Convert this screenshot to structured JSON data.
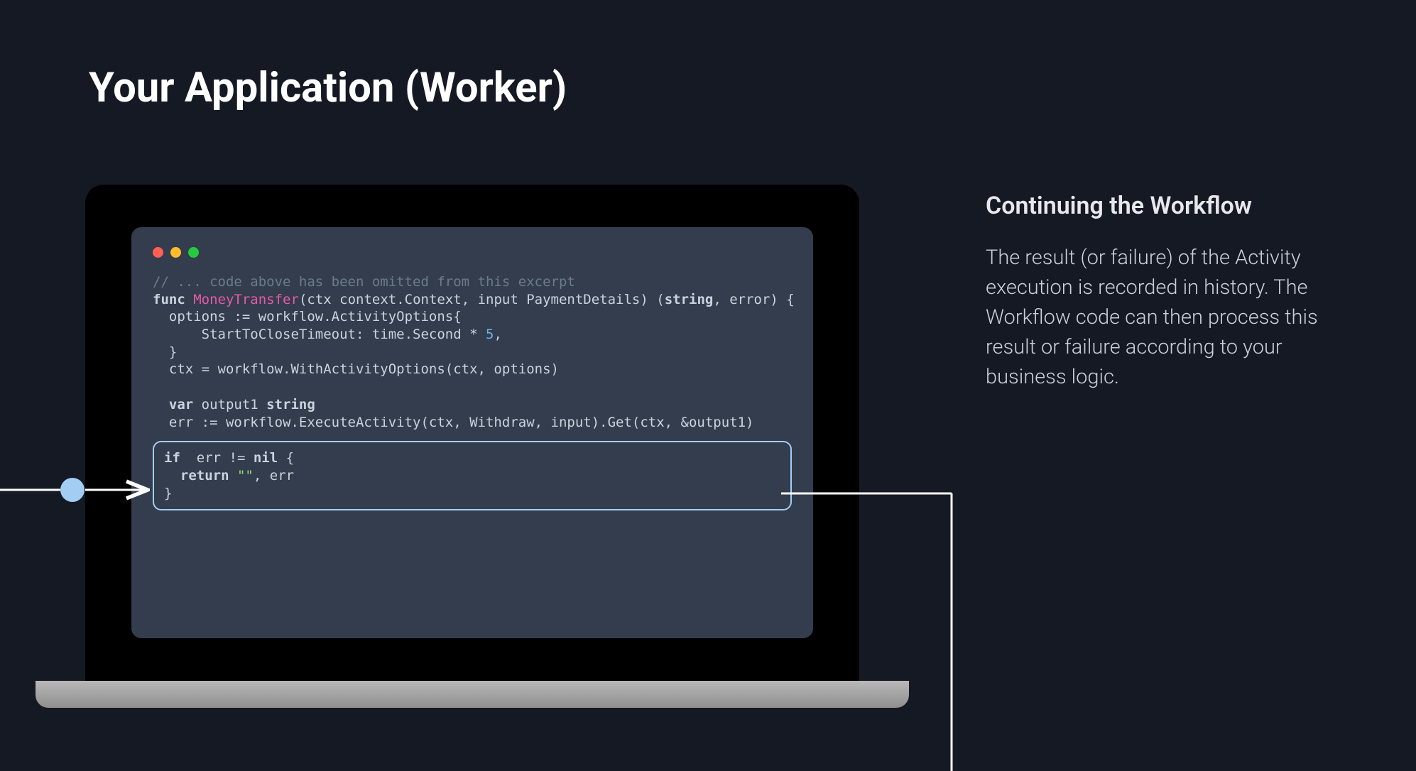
{
  "title": "Your Application (Worker)",
  "sidebar": {
    "heading": "Continuing the Workflow",
    "body": "The result (or failure) of the Activity execution is recorded in history. The Workflow code can then process this result or failure according to your business logic."
  },
  "code": {
    "comment": "// ... code above has been omitted from this excerpt",
    "func_kw": "func",
    "func_name": "MoneyTransfer",
    "signature_part1": "(ctx context.Context, input PaymentDetails) (",
    "string_type": "string",
    "signature_part2": ", error) {",
    "line_options": "  options := workflow.ActivityOptions{",
    "line_timeout_pre": "      StartToCloseTimeout: time.Second * ",
    "line_timeout_num": "5",
    "line_timeout_post": ",",
    "line_closebrace": "  }",
    "line_ctx": "  ctx = workflow.WithActivityOptions(ctx, options)",
    "var_kw": "var",
    "var_name": " output1 ",
    "var_type": "string",
    "line_exec": "  err := workflow.ExecuteActivity(ctx, Withdraw, input).Get(ctx, &output1)",
    "if_kw": "if",
    "if_cond_pre": "  err != ",
    "nil_kw": "nil",
    "if_cond_post": " {",
    "return_kw": "return",
    "return_str": "\"\"",
    "return_rest": ", err",
    "close_if": "}"
  }
}
